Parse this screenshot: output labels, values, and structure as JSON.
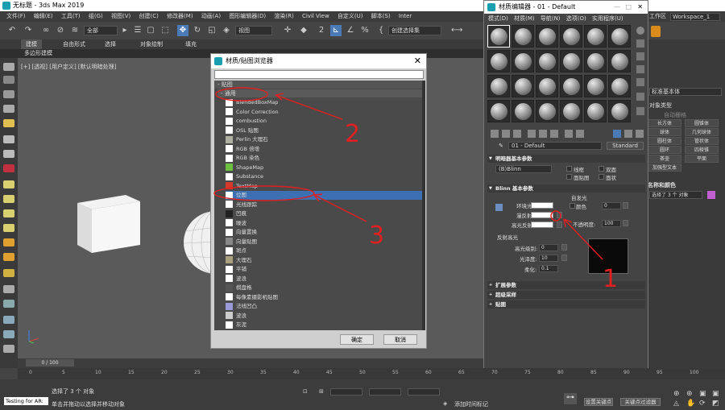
{
  "window": {
    "title": "无标题 - 3ds Max 2019"
  },
  "menu": [
    "文件(F)",
    "编辑(E)",
    "工具(T)",
    "组(G)",
    "视图(V)",
    "创建(C)",
    "修改器(M)",
    "动画(A)",
    "图形编辑器(D)",
    "渲染(R)",
    "Civil View",
    "自定义(U)",
    "脚本(S)",
    "Inter"
  ],
  "menu_right": {
    "workspace_label": "工作区",
    "workspace_value": "Workspace_1"
  },
  "toolbar": {
    "filter_all": "全部",
    "view_select": "视图",
    "selection_set": "创建选择集"
  },
  "ribbon": {
    "tabs": [
      "建模",
      "自由形式",
      "选择",
      "对象绘制",
      "填充"
    ],
    "sub": "多边形建模"
  },
  "viewport": {
    "label": "[+] [透视] [用户定义] [默认明暗处理]"
  },
  "material_browser": {
    "title": "材质/贴图浏览器",
    "section": "- 贴图",
    "group": "- 通用",
    "items": [
      {
        "label": "BlendedBoxMap",
        "color": "#ffffff"
      },
      {
        "label": "Color Correction",
        "color": "#ffffff"
      },
      {
        "label": "combustion",
        "color": "#ffffff"
      },
      {
        "label": "OSL 贴图",
        "color": "#ffffff"
      },
      {
        "label": "Perlin 大理石",
        "color": "#b0b0a0"
      },
      {
        "label": "RGB 倍增",
        "color": "#ffffff"
      },
      {
        "label": "RGB 染色",
        "color": "#ffffff"
      },
      {
        "label": "ShapeMap",
        "color": "#6cbf3f"
      },
      {
        "label": "Substance",
        "color": "#ffffff"
      },
      {
        "label": "TextMap",
        "color": "#d63a2a"
      },
      {
        "label": "位图",
        "color": "#ffffff"
      },
      {
        "label": "光线跟踪",
        "color": "#ffffff"
      },
      {
        "label": "凹痕",
        "color": "#222222"
      },
      {
        "label": "噪波",
        "color": "#ffffff"
      },
      {
        "label": "向量置换",
        "color": "#ffffff"
      },
      {
        "label": "向量贴图",
        "color": "#888888"
      },
      {
        "label": "斑点",
        "color": "#ffffff"
      },
      {
        "label": "大理石",
        "color": "#aaa080"
      },
      {
        "label": "平铺",
        "color": "#ffffff"
      },
      {
        "label": "波浪",
        "color": "#ffffff"
      },
      {
        "label": "棋盘格",
        "color": "#555555"
      },
      {
        "label": "每像素摄影机贴图",
        "color": "#ffffff"
      },
      {
        "label": "法线凹凸",
        "color": "#9a9ad8"
      },
      {
        "label": "波浪",
        "color": "#cccccc"
      },
      {
        "label": "灰泥",
        "color": "#ffffff"
      }
    ],
    "ok": "确定",
    "cancel": "取消"
  },
  "material_editor": {
    "title": "材质编辑器 - 01 - Default",
    "menu": [
      "模式(D)",
      "材质(M)",
      "导航(N)",
      "选项(O)",
      "实用程序(U)"
    ],
    "material_name": "01 - Default",
    "material_type": "Standard",
    "shader_head": "明暗器基本参数",
    "shader": "(B)Blinn",
    "wire": "线框",
    "two_sided": "双面",
    "face_map": "面贴图",
    "faceted": "面状",
    "blinn_head": "Blinn 基本参数",
    "self_illum": "自发光",
    "color": "颜色",
    "color_val": "0",
    "ambient": "环境光:",
    "diffuse": "漫反射:",
    "specular": "高光反射:",
    "opacity": "不透明度:",
    "opacity_val": "100",
    "spec_highlights": "反射高光",
    "spec_level": "高光级别:",
    "spec_level_val": "0",
    "glossiness": "光泽度:",
    "glossiness_val": "10",
    "soften": "柔化:",
    "soften_val": "0.1",
    "rollouts": [
      "扩展参数",
      "超级采样",
      "贴图"
    ]
  },
  "command_panel": {
    "dropdown": "标准基本体",
    "obj_type": "对象类型",
    "auto_grid": "自动栅格",
    "buttons": [
      "长方体",
      "圆锥体",
      "球体",
      "几何球体",
      "圆柱体",
      "管状体",
      "圆环",
      "四棱锥",
      "茶壶",
      "平面",
      "加强型文本"
    ],
    "name_color": "名称和颜色",
    "name_value": "选择了 3 个 对象"
  },
  "timeline": {
    "range": "0 / 100"
  },
  "ruler_ticks": [
    "0",
    "5",
    "10",
    "15",
    "20",
    "25",
    "30",
    "35",
    "40",
    "45",
    "50",
    "55",
    "60",
    "65",
    "70",
    "75",
    "80",
    "85",
    "90",
    "95",
    "100"
  ],
  "status": {
    "maxscript": "Testing for AR:",
    "selected": "选择了 3 个 对象",
    "hint": "单击并拖动以选择并移动对象",
    "grid": "栅格 = 10.0mm",
    "add_time_tag": "添加时间标记",
    "set_key": "设置关键点",
    "key_filter": "关键点过滤器"
  },
  "annotations": [
    "2",
    "3",
    "1"
  ]
}
